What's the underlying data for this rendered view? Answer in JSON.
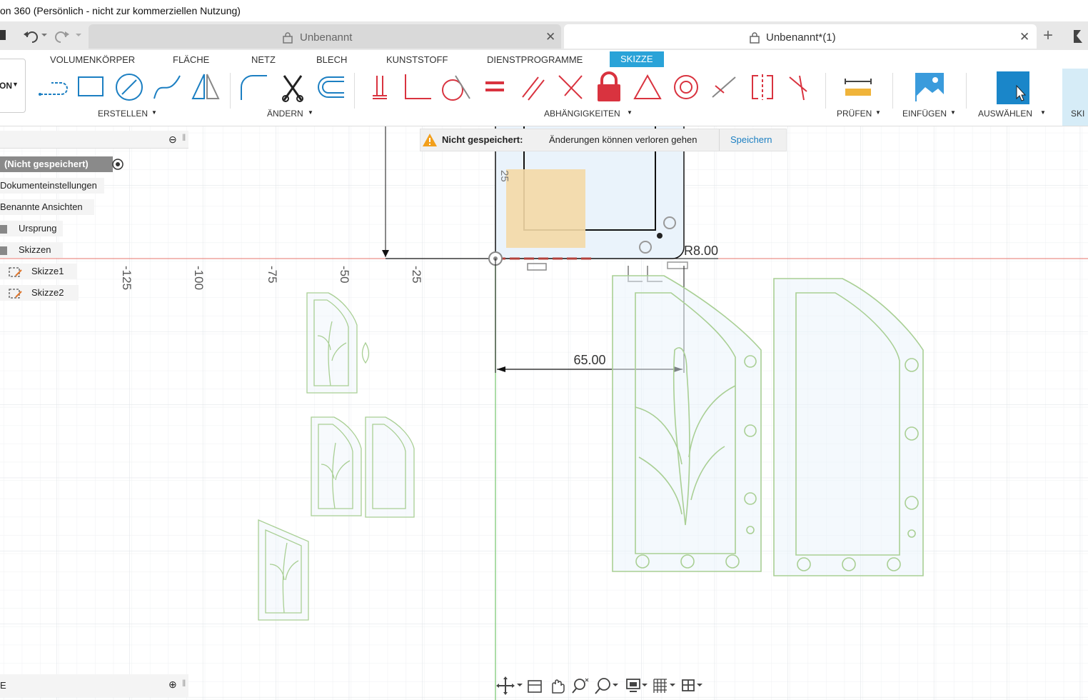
{
  "app": {
    "title": "on 360 (Persönlich - nicht zur kommerziellen Nutzung)"
  },
  "tabs": [
    {
      "label": "Unbenannt",
      "active": false
    },
    {
      "label": "Unbenannt*(1)",
      "active": true
    }
  ],
  "ribbon": {
    "categories": [
      "VOLUMENKÖRPER",
      "FLÄCHE",
      "NETZ",
      "BLECH",
      "KUNSTSTOFF",
      "DIENSTPROGRAMME",
      "SKIZZE"
    ],
    "active_category": "SKIZZE",
    "workspace_label": "ON",
    "groups": [
      "ERSTELLEN",
      "ÄNDERN",
      "ABHÄNGIGKEITEN",
      "PRÜFEN",
      "EINFÜGEN",
      "AUSWÄHLEN",
      "SKI"
    ]
  },
  "browser": {
    "doc_label": "(Nicht gespeichert)",
    "items": [
      "Dokumenteinstellungen",
      "Benannte Ansichten",
      "Ursprung",
      "Skizzen",
      "Skizze1",
      "Skizze2"
    ],
    "bottom_label": "E"
  },
  "warning": {
    "title": "Nicht gespeichert:",
    "message": "Änderungen können verloren gehen",
    "action": "Speichern"
  },
  "canvas": {
    "ruler_labels": [
      "-125",
      "-100",
      "-75",
      "-50",
      "-25",
      "25"
    ],
    "dimension_width": "65.00",
    "dimension_radius": "R8.00"
  },
  "colors": {
    "accent": "#2aa3d8",
    "constraint_red": "#d9333f",
    "sketch_green": "#a9cf94",
    "rect_fill": "#f4d9a6"
  }
}
